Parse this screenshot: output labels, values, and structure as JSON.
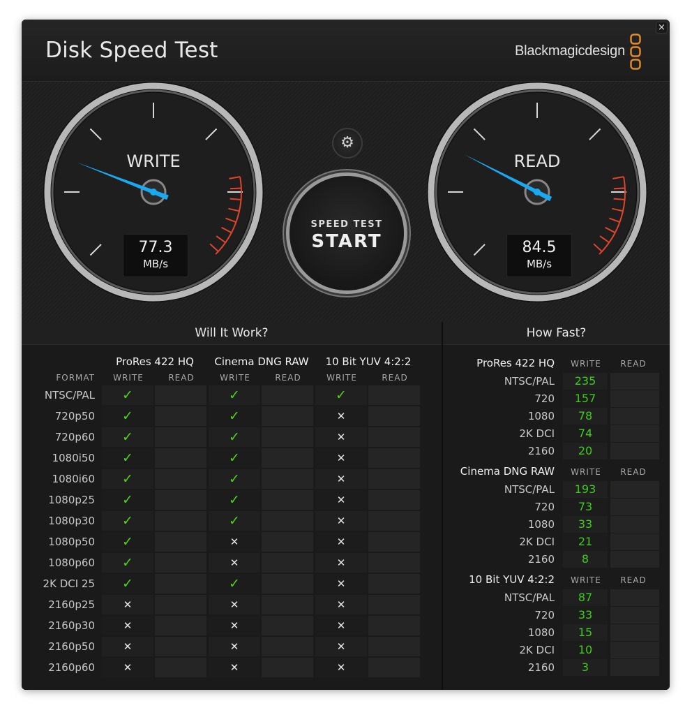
{
  "window": {
    "title": "Disk Speed Test",
    "brand": "Blackmagicdesign",
    "close_glyph": "×"
  },
  "gauges": {
    "write": {
      "label": "WRITE",
      "value": "77.3",
      "unit": "MB/s"
    },
    "read": {
      "label": "READ",
      "value": "84.5",
      "unit": "MB/s"
    }
  },
  "controls": {
    "settings_icon": "⚙",
    "start_line1": "SPEED TEST",
    "start_line2": "START"
  },
  "will_it_work": {
    "title": "Will It Work?",
    "format_header": "FORMAT",
    "codecs": [
      "ProRes 422 HQ",
      "Cinema DNG RAW",
      "10 Bit YUV 4:2:2"
    ],
    "sub_headers": [
      "WRITE",
      "READ"
    ],
    "rows": [
      {
        "format": "NTSC/PAL",
        "write": [
          true,
          true,
          true
        ]
      },
      {
        "format": "720p50",
        "write": [
          true,
          true,
          false
        ]
      },
      {
        "format": "720p60",
        "write": [
          true,
          true,
          false
        ]
      },
      {
        "format": "1080i50",
        "write": [
          true,
          true,
          false
        ]
      },
      {
        "format": "1080i60",
        "write": [
          true,
          true,
          false
        ]
      },
      {
        "format": "1080p25",
        "write": [
          true,
          true,
          false
        ]
      },
      {
        "format": "1080p30",
        "write": [
          true,
          true,
          false
        ]
      },
      {
        "format": "1080p50",
        "write": [
          true,
          false,
          false
        ]
      },
      {
        "format": "1080p60",
        "write": [
          true,
          false,
          false
        ]
      },
      {
        "format": "2K DCI 25",
        "write": [
          true,
          true,
          false
        ]
      },
      {
        "format": "2160p25",
        "write": [
          false,
          false,
          false
        ]
      },
      {
        "format": "2160p30",
        "write": [
          false,
          false,
          false
        ]
      },
      {
        "format": "2160p50",
        "write": [
          false,
          false,
          false
        ]
      },
      {
        "format": "2160p60",
        "write": [
          false,
          false,
          false
        ]
      }
    ],
    "check_glyph": "✓",
    "cross_glyph": "✕"
  },
  "how_fast": {
    "title": "How Fast?",
    "sub_headers": [
      "WRITE",
      "READ"
    ],
    "groups": [
      {
        "codec": "ProRes 422 HQ",
        "rows": [
          {
            "format": "NTSC/PAL",
            "write": "235"
          },
          {
            "format": "720",
            "write": "157"
          },
          {
            "format": "1080",
            "write": "78"
          },
          {
            "format": "2K DCI",
            "write": "74"
          },
          {
            "format": "2160",
            "write": "20"
          }
        ]
      },
      {
        "codec": "Cinema DNG RAW",
        "rows": [
          {
            "format": "NTSC/PAL",
            "write": "193"
          },
          {
            "format": "720",
            "write": "73"
          },
          {
            "format": "1080",
            "write": "33"
          },
          {
            "format": "2K DCI",
            "write": "21"
          },
          {
            "format": "2160",
            "write": "8"
          }
        ]
      },
      {
        "codec": "10 Bit YUV 4:2:2",
        "rows": [
          {
            "format": "NTSC/PAL",
            "write": "87"
          },
          {
            "format": "720",
            "write": "33"
          },
          {
            "format": "1080",
            "write": "15"
          },
          {
            "format": "2K DCI",
            "write": "10"
          },
          {
            "format": "2160",
            "write": "3"
          }
        ]
      }
    ]
  },
  "colors": {
    "background": "#141414",
    "check": "#52d21e",
    "number": "#40cc1a",
    "needle": "#19a9f0",
    "redline": "#e0442c",
    "logo_orange": "#e08a2c"
  }
}
